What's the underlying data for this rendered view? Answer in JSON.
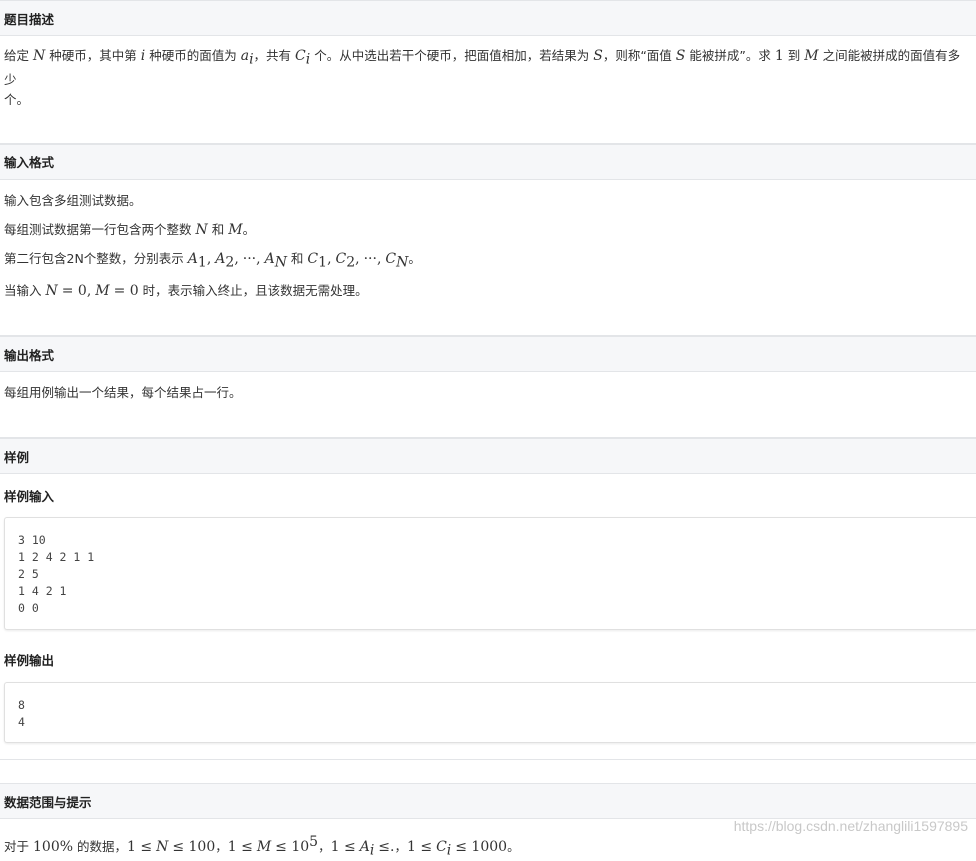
{
  "description": {
    "heading": "题目描述",
    "p1": "给定",
    "p2": "种硬币，其中第",
    "p3": "种硬币的面值为",
    "p4": "，共有",
    "p5": "个。从中选出若干个硬币，把面值相加，若结果为",
    "p6": "，则称“面值",
    "p7": "能被拼成”。求",
    "p8": "到",
    "p9": "之间能被拼成的面值有多少",
    "p10": "个。",
    "v_N": "N",
    "v_i": "i",
    "v_a": "a",
    "v_C": "C",
    "v_S": "S",
    "v_one": "1",
    "v_M": "M"
  },
  "input_format": {
    "heading": "输入格式",
    "line1": "输入包含多组测试数据。",
    "line2_a": "每组测试数据第一行包含两个整数",
    "line2_b": "和",
    "line2_c": "。",
    "line3_a": "第二行包含2N个整数，分别表示",
    "line3_b": "和",
    "line3_c": "。",
    "line4_a": "当输入",
    "line4_b": "时，表示输入终止，且该数据无需处理。",
    "v_N": "N",
    "v_M": "M",
    "v_A": "A",
    "v_C": "C",
    "sub_1": "1",
    "sub_2": "2",
    "sub_N": "N",
    "comma": ",",
    "dots": "···",
    "eq_zero": "= 0,",
    "eq_zero2": "= 0"
  },
  "output_format": {
    "heading": "输出格式",
    "line1": "每组用例输出一个结果，每个结果占一行。"
  },
  "sample": {
    "heading": "样例",
    "input_label": "样例输入",
    "input_text": "3 10\n1 2 4 2 1 1\n2 5\n1 4 2 1\n0 0",
    "output_label": "样例输出",
    "output_text": "8\n4"
  },
  "constraints": {
    "heading": "数据范围与提示",
    "a": "对于",
    "pct": "100%",
    "b": "的数据，",
    "c1": "1 ≤",
    "c1v": "N",
    "c1e": "≤ 100",
    "sep": "，",
    "c2": "1 ≤",
    "c2v": "M",
    "c2e": "≤ 10",
    "c2sup": "5",
    "c3": "1 ≤",
    "c3v": "A",
    "c3sub": "i",
    "c3e": "≤.",
    "c4": "1 ≤",
    "c4v": "C",
    "c4sub": "i",
    "c4e": "≤ 1000",
    "end": "。"
  },
  "watermark": "https://blog.csdn.net/zhanglili1597895"
}
